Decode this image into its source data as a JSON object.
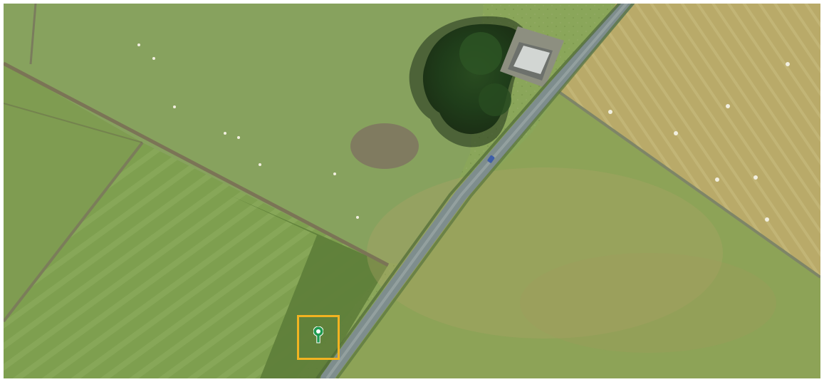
{
  "map": {
    "view": "satellite",
    "accent_color": "#f2b321",
    "marker_color": "#1e9a4f",
    "marker_icon": "location-pin-icon"
  }
}
